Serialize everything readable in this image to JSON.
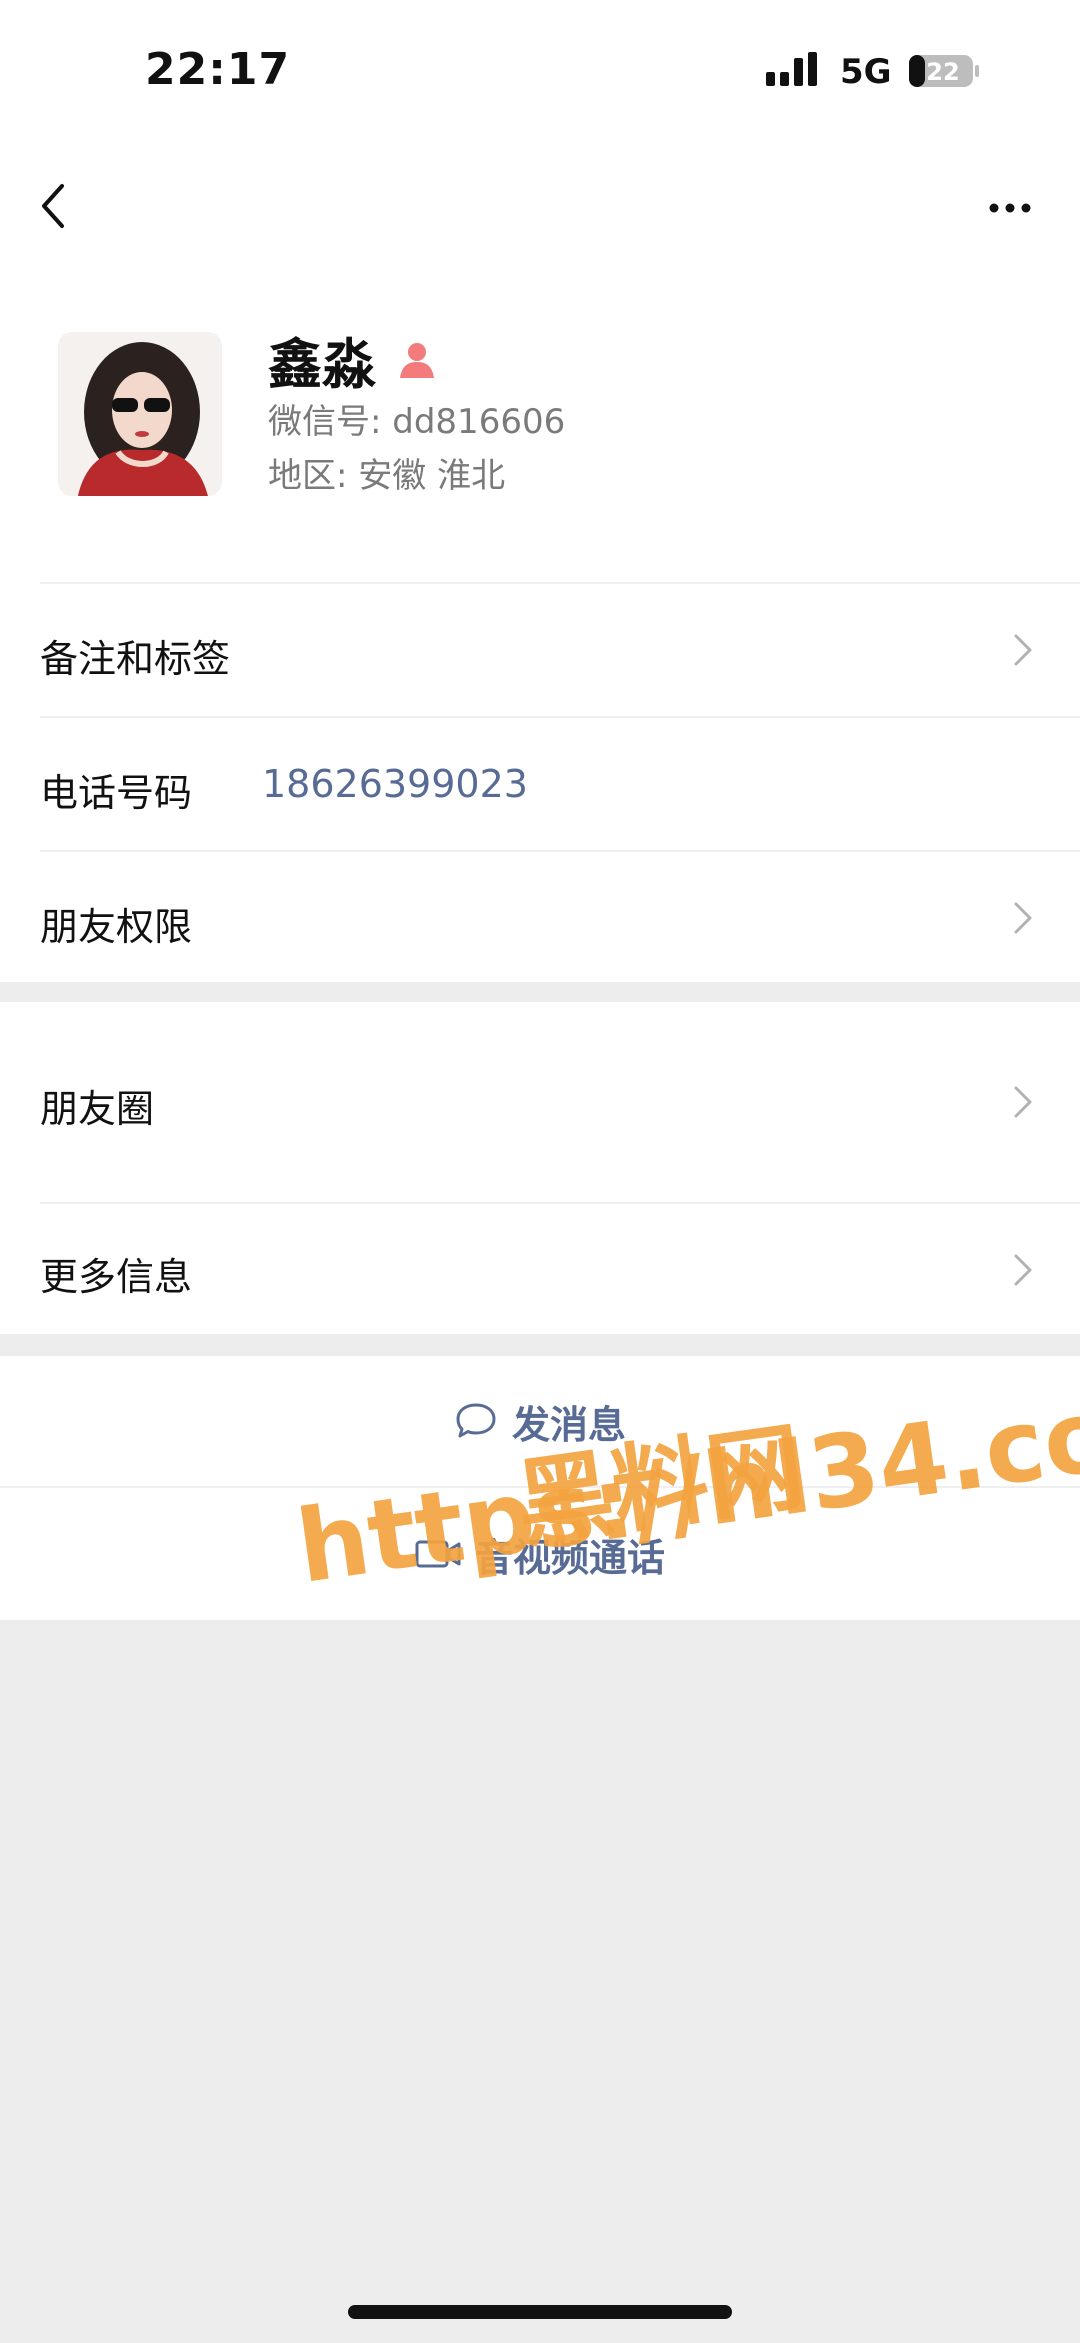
{
  "status_bar": {
    "time": "22:17",
    "network": "5G",
    "battery": "22"
  },
  "profile": {
    "name": "鑫淼",
    "wechat_id": "微信号: dd816606",
    "region": "地区: 安徽 淮北"
  },
  "info_rows": [
    {
      "label": "备注和标签"
    },
    {
      "label": "电话号码",
      "value": "18626399023"
    },
    {
      "label": "朋友权限"
    }
  ],
  "more_rows": [
    {
      "label": "朋友圈"
    },
    {
      "label": "更多信息"
    }
  ],
  "actions": {
    "message": "发消息",
    "call": "音视频通话"
  },
  "watermark": {
    "line1": "黑料网",
    "line2": "https://hl34.co"
  },
  "colors": {
    "link": "#576b95",
    "background": "#ededed",
    "accent_female": "#f37b7b",
    "watermark": "#f4a340"
  }
}
